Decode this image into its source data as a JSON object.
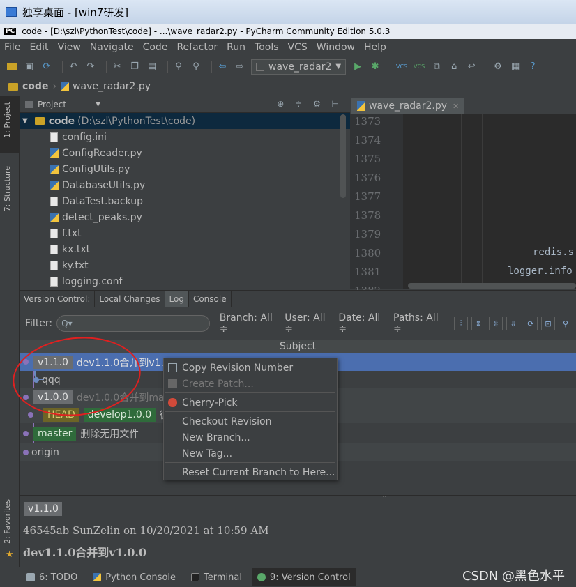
{
  "window": {
    "title": "独享桌面 - [win7研发]",
    "app_title": "code - [D:\\szl\\PythonTest\\code] - ...\\wave_radar2.py - PyCharm Community Edition 5.0.3",
    "app_badge": "PC"
  },
  "menu": [
    "File",
    "Edit",
    "View",
    "Navigate",
    "Code",
    "Refactor",
    "Run",
    "Tools",
    "VCS",
    "Window",
    "Help"
  ],
  "toolbar": {
    "run_config": "wave_radar2"
  },
  "breadcrumb": {
    "folder": "code",
    "file": "wave_radar2.py"
  },
  "left_stripe": {
    "project": "1: Project",
    "structure": "7: Structure",
    "favorites": "2: Favorites"
  },
  "project": {
    "header": "Project",
    "root_name": "code",
    "root_path": "(D:\\szl\\PythonTest\\code)",
    "files": [
      {
        "name": "config.ini",
        "type": "txt"
      },
      {
        "name": "ConfigReader.py",
        "type": "py"
      },
      {
        "name": "ConfigUtils.py",
        "type": "py"
      },
      {
        "name": "DatabaseUtils.py",
        "type": "py"
      },
      {
        "name": "DataTest.backup",
        "type": "txt"
      },
      {
        "name": "detect_peaks.py",
        "type": "py"
      },
      {
        "name": "f.txt",
        "type": "txt"
      },
      {
        "name": "kx.txt",
        "type": "txt"
      },
      {
        "name": "ky.txt",
        "type": "txt"
      },
      {
        "name": "logging.conf",
        "type": "txt"
      }
    ]
  },
  "editor": {
    "tab": "wave_radar2.py",
    "line_numbers": [
      "1373",
      "1374",
      "1375",
      "1376",
      "1377",
      "1378",
      "1379",
      "1380",
      "1381",
      "1382"
    ],
    "code_lines": [
      {
        "line": "1380",
        "text": "redis.s"
      },
      {
        "line": "1381",
        "text": "logger.info"
      }
    ]
  },
  "vc": {
    "tabs": [
      {
        "label": "Version Control:",
        "active": false
      },
      {
        "label": "Local Changes",
        "active": false
      },
      {
        "label": "Log",
        "active": true
      },
      {
        "label": "Console",
        "active": false
      }
    ],
    "filter_label": "Filter:",
    "filter_placeholder": "Q▾",
    "dropdowns": [
      "Branch: All ≑",
      "User: All ≑",
      "Date: All ≑",
      "Paths: All ≑"
    ],
    "subject_header": "Subject",
    "rows": [
      {
        "tags": [
          {
            "text": "v1.1.0",
            "style": "gray"
          }
        ],
        "message": "dev1.1.0合并到v1.0.0",
        "selected": true
      },
      {
        "tags": [],
        "message": "qqq"
      },
      {
        "tags": [
          {
            "text": "v1.0.0",
            "style": "gray"
          }
        ],
        "message": "dev1.0.0合并到master",
        "dim": true
      },
      {
        "tags": [
          {
            "text": "HEAD",
            "style": "olive"
          },
          {
            "text": "develop1.0.0",
            "style": "green"
          }
        ],
        "message": "循环"
      },
      {
        "tags": [
          {
            "text": "master",
            "style": "green"
          }
        ],
        "message": "删除无用文件"
      },
      {
        "tags": [],
        "message": "origin"
      }
    ]
  },
  "context_menu": {
    "items": [
      {
        "label": "Copy Revision Number",
        "enabled": true,
        "icon": "copy-icon"
      },
      {
        "label": "Create Patch...",
        "enabled": false,
        "icon": "patch-icon"
      },
      {
        "label": "Cherry-Pick",
        "enabled": true,
        "icon": "cherry-icon"
      },
      {
        "label": "Checkout Revision",
        "enabled": true
      },
      {
        "label": "New Branch...",
        "enabled": true
      },
      {
        "label": "New Tag...",
        "enabled": true
      },
      {
        "label": "Reset Current Branch to Here...",
        "enabled": true
      }
    ]
  },
  "details": {
    "tag": "v1.1.0",
    "info": "46545ab SunZelin on 10/20/2021 at 10:59 AM",
    "message": "dev1.1.0合并到v1.0.0"
  },
  "bottom": {
    "tools": [
      {
        "label": "6: TODO",
        "active": false
      },
      {
        "label": "Python Console",
        "active": false
      },
      {
        "label": "Terminal",
        "active": false
      },
      {
        "label": "9: Version Control",
        "active": true
      }
    ],
    "watermark": "CSDN @黑色水平"
  },
  "colors": {
    "selection": "#4b6eaf",
    "annotation": "#e02020",
    "accent_green": "#2f6b3b"
  }
}
